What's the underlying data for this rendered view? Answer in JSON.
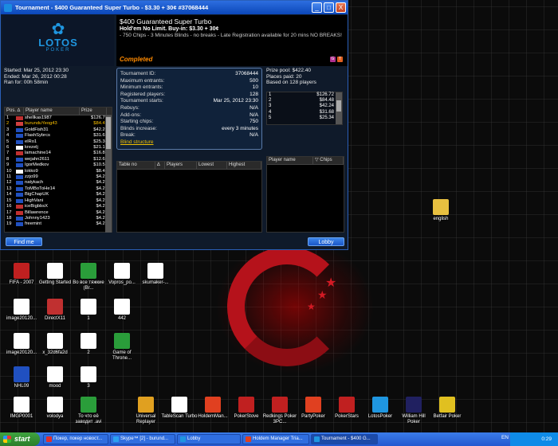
{
  "window": {
    "title": "Tournament - $400 Guaranteed Super Turbo - $3.30 + 30¢ #37068444",
    "minimize": "_",
    "maximize": "□",
    "close": "X"
  },
  "logo": {
    "brand": "LOTOS",
    "sub": "POKER"
  },
  "header": {
    "title": "$400 Guaranteed Super Turbo",
    "subtitle": "Hold'em No Limit. Buy-in: $3.30 + 30¢",
    "details": "- 750 Chips   - 3 Minutes Blinds - no breaks   - Late Registration available for 20 mins   NO BREAKS!",
    "status": "Completed",
    "icon_g": "G",
    "icon_t": "T"
  },
  "dates": {
    "started": "Started: Mar 25, 2012 23:30",
    "ended": "Ended: Mar 26, 2012 00:28",
    "ran_for": "Ran for: 00h 58min"
  },
  "info": {
    "rows": [
      {
        "k": "Tournament ID:",
        "v": "37068444"
      },
      {
        "k": "Maximum entrants:",
        "v": "500"
      },
      {
        "k": "Minimum entrants:",
        "v": "10"
      },
      {
        "k": "Registered players:",
        "v": "128"
      },
      {
        "k": "Tournament starts:",
        "v": "Mar 25, 2012 23:30"
      },
      {
        "k": "Rebuys:",
        "v": "N/A"
      },
      {
        "k": "Add-ons:",
        "v": "N/A"
      },
      {
        "k": "Starting chips:",
        "v": "750"
      },
      {
        "k": "Blinds increase:",
        "v": "every 3 minutes"
      },
      {
        "k": "Break:",
        "v": "N/A"
      }
    ],
    "blind_link": "Blind structure"
  },
  "prize": {
    "pool": "Prize pool: $422.40",
    "places": "Places paid: 20",
    "based": "Based on 128 players",
    "list": [
      {
        "pos": "1",
        "amt": "$126.72"
      },
      {
        "pos": "2",
        "amt": "$84.48"
      },
      {
        "pos": "3",
        "amt": "$42.24"
      },
      {
        "pos": "4",
        "amt": "$31.68"
      },
      {
        "pos": "5",
        "amt": "$25.34"
      }
    ]
  },
  "players_table": {
    "headers": [
      "Pos. ∆",
      "Player name",
      "Prize"
    ],
    "rows": [
      {
        "pos": "1",
        "name": "shellkas1987",
        "prize": "$126.72",
        "flag": "#c03030"
      },
      {
        "pos": "2",
        "name": "burunduYeog43",
        "prize": "$84.48",
        "flag": "#d04040"
      },
      {
        "pos": "3",
        "name": "GoldFish31",
        "prize": "$42.24",
        "flag": "#2050c0"
      },
      {
        "pos": "4",
        "name": "FlashSybrcs",
        "prize": "$31.68",
        "flag": "#2050c0"
      },
      {
        "pos": "5",
        "name": "elRo1",
        "prize": "$25.34",
        "flag": "#2050c0"
      },
      {
        "pos": "6",
        "name": "krezelj",
        "prize": "$21.12",
        "flag": "#ffffff"
      },
      {
        "pos": "7",
        "name": "lamachine14",
        "prize": "$16.89",
        "flag": "#c03030"
      },
      {
        "pos": "8",
        "name": "wejahn2611",
        "prize": "$12.67",
        "flag": "#2050c0"
      },
      {
        "pos": "9",
        "name": "IgorMedkov",
        "prize": "$10.56",
        "flag": "#2050c0"
      },
      {
        "pos": "10",
        "name": "lokko9",
        "prize": "$8.44",
        "flag": "#ffffff"
      },
      {
        "pos": "11",
        "name": "zzjo99",
        "prize": "$4.22",
        "flag": "#2050c0"
      },
      {
        "pos": "12",
        "name": "natykach",
        "prize": "$4.22",
        "flag": "#2050c0"
      },
      {
        "pos": "13",
        "name": "ToMBoToHe14",
        "prize": "$4.22",
        "flag": "#2050c0"
      },
      {
        "pos": "14",
        "name": "BigChapUK",
        "prize": "$4.22",
        "flag": "#2050c0"
      },
      {
        "pos": "15",
        "name": "HighVani",
        "prize": "$4.22",
        "flag": "#2050c0"
      },
      {
        "pos": "16",
        "name": "iceBigbbsX",
        "prize": "$4.22",
        "flag": "#c03030"
      },
      {
        "pos": "17",
        "name": "Billawrence",
        "prize": "$4.22",
        "flag": "#c03030"
      },
      {
        "pos": "18",
        "name": "Johnny1423",
        "prize": "$4.22",
        "flag": "#2050c0"
      },
      {
        "pos": "19",
        "name": "freemint",
        "prize": "$4.22",
        "flag": "#2050c0"
      }
    ]
  },
  "tables_table": {
    "headers": [
      "Table no",
      "∆",
      "Players",
      "Lowest",
      "Highest"
    ]
  },
  "table_players": {
    "headers": [
      "Player name",
      "▽ Chips"
    ]
  },
  "buttons": {
    "find_me": "Find me",
    "lobby": "Lobby"
  },
  "desktop": {
    "icons": [
      {
        "label": "english",
        "color": "#e8c040"
      },
      {
        "label": "FIFA - 2007",
        "color": "#c02020"
      },
      {
        "label": "Getting Started",
        "color": "#ffffff"
      },
      {
        "label": "Во все тяжкие (Br...",
        "color": "#2a9d3a"
      },
      {
        "label": "Vopros_po...",
        "color": "#ffffff"
      },
      {
        "label": "skumaker-...",
        "color": "#ffffff"
      },
      {
        "label": "image20120...",
        "color": "#ffffff"
      },
      {
        "label": "DirectX11",
        "color": "#c03030"
      },
      {
        "label": "1",
        "color": "#ffffff"
      },
      {
        "label": "442",
        "color": "#ffffff"
      },
      {
        "label": "image20120...",
        "color": "#ffffff"
      },
      {
        "label": "x_32d6fa2d",
        "color": "#ffffff"
      },
      {
        "label": "2",
        "color": "#ffffff"
      },
      {
        "label": "Game of Throne...",
        "color": "#2a9d3a"
      },
      {
        "label": "NHL09",
        "color": "#2050c0"
      },
      {
        "label": "mood",
        "color": "#ffffff"
      },
      {
        "label": "3",
        "color": "#ffffff"
      },
      {
        "label": "IMGP0001",
        "color": "#ffffff"
      },
      {
        "label": "volodya",
        "color": "#ffffff"
      },
      {
        "label": "То что её заводит .avi",
        "color": "#2a9d3a"
      },
      {
        "label": "Universal Replayer",
        "color": "#e0a020"
      },
      {
        "label": "TableScan Turbo",
        "color": "#ffffff"
      },
      {
        "label": "HoldemMan...",
        "color": "#e04020"
      },
      {
        "label": "PokerStove",
        "color": "#c02020"
      },
      {
        "label": "Redkings Poker 3PC...",
        "color": "#c02020"
      },
      {
        "label": "PartyPoker",
        "color": "#e04020"
      },
      {
        "label": "PokerStars",
        "color": "#c02020"
      },
      {
        "label": "LotosPoker",
        "color": "#1f96e0"
      },
      {
        "label": "William Hill Poker",
        "color": "#202060"
      },
      {
        "label": "Betfair Poker",
        "color": "#e0c020"
      }
    ]
  },
  "taskbar": {
    "start": "start",
    "tasks": [
      {
        "label": "Покер, покер новост...",
        "color": "#e03030"
      },
      {
        "label": "Skype™ [2] - burund...",
        "color": "#2aa0f0"
      },
      {
        "label": "Lobby",
        "color": "#1f96e0"
      },
      {
        "label": "Holdem Manager Tria...",
        "color": "#e04020"
      },
      {
        "label": "Tournament - $400 G...",
        "color": "#1f96e0"
      }
    ],
    "lang": "EN",
    "clock": "0:29"
  }
}
